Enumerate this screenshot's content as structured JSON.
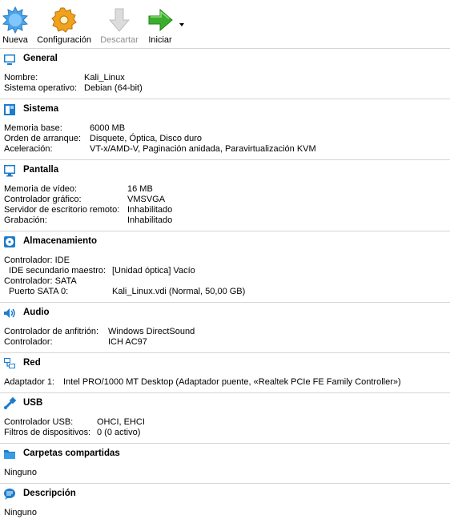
{
  "toolbar": {
    "new_label": "Nueva",
    "settings_label": "Configuración",
    "discard_label": "Descartar",
    "start_label": "Iniciar"
  },
  "sections": {
    "general": {
      "title": "General",
      "rows": [
        {
          "k": "Nombre:",
          "v": "Kali_Linux"
        },
        {
          "k": "Sistema operativo:",
          "v": "Debian (64-bit)"
        }
      ]
    },
    "sistema": {
      "title": "Sistema",
      "rows": [
        {
          "k": "Memoria base:",
          "v": "6000 MB"
        },
        {
          "k": "Orden de arranque:",
          "v": "Disquete, Óptica, Disco duro"
        },
        {
          "k": "Aceleración:",
          "v": "VT-x/AMD-V, Paginación anidada, Paravirtualización KVM"
        }
      ]
    },
    "pantalla": {
      "title": "Pantalla",
      "rows": [
        {
          "k": "Memoria de vídeo:",
          "v": "16 MB"
        },
        {
          "k": "Controlador gráfico:",
          "v": "VMSVGA"
        },
        {
          "k": "Servidor de escritorio remoto:",
          "v": "Inhabilitado"
        },
        {
          "k": "Grabación:",
          "v": "Inhabilitado"
        }
      ]
    },
    "almacenamiento": {
      "title": "Almacenamiento",
      "rows": [
        {
          "k": "Controlador: IDE",
          "v": ""
        },
        {
          "k": " IDE secundario maestro:",
          "v": "[Unidad óptica] Vacío"
        },
        {
          "k": "Controlador: SATA",
          "v": ""
        },
        {
          "k": " Puerto SATA 0:",
          "v": "Kali_Linux.vdi (Normal, 50,00 GB)"
        }
      ]
    },
    "audio": {
      "title": "Audio",
      "rows": [
        {
          "k": "Controlador de anfitrión:",
          "v": "Windows DirectSound"
        },
        {
          "k": "Controlador:",
          "v": "ICH AC97"
        }
      ]
    },
    "red": {
      "title": "Red",
      "rows": [
        {
          "k": "Adaptador 1:",
          "v": "Intel PRO/1000 MT Desktop (Adaptador puente, «Realtek PCIe FE Family Controller»)"
        }
      ]
    },
    "usb": {
      "title": "USB",
      "rows": [
        {
          "k": "Controlador USB:",
          "v": "OHCI, EHCI"
        },
        {
          "k": "Filtros de dispositivos:",
          "v": "0 (0 activo)"
        }
      ]
    },
    "carpetas": {
      "title": "Carpetas compartidas",
      "text": "Ninguno"
    },
    "descripcion": {
      "title": "Descripción",
      "text": "Ninguno"
    }
  },
  "colors": {
    "section_icon_blue": "#1c7ccd",
    "start_green": "#3cae2d",
    "settings_orange": "#f0a21c",
    "new_blue": "#4ba3e8"
  }
}
